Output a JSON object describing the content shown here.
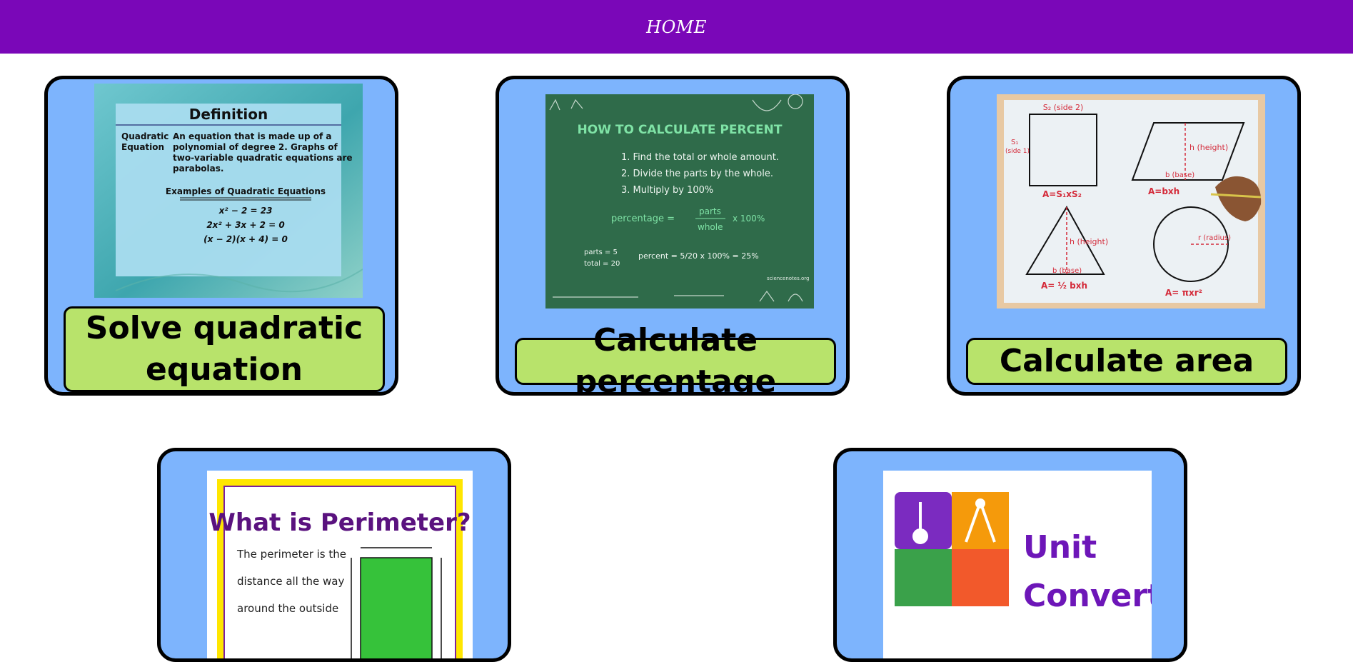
{
  "nav": {
    "home": "HOME"
  },
  "colors": {
    "header": "#7a07b8",
    "card_bg": "#7db4fd",
    "label_bg": "#b8e36b",
    "border": "#000000"
  },
  "cards": [
    {
      "label": "Solve quadratic equation",
      "thumb": {
        "title": "Definition",
        "term": "Quadratic Equation",
        "term_line1": "Quadratic",
        "term_line2": "Equation",
        "def_lines": [
          "An equation that is made up of a",
          "polynomial of degree 2. Graphs of",
          "two-variable quadratic equations are",
          "parabolas."
        ],
        "examples_heading": "Examples of Quadratic Equations",
        "examples": [
          "x² − 2 = 23",
          "2x² + 3x + 2 = 0",
          "(x − 2)(x + 4) = 0"
        ]
      }
    },
    {
      "label": "Calculate percentage",
      "thumb": {
        "title": "HOW TO CALCULATE PERCENT",
        "steps": [
          "1.  Find the total or whole amount.",
          "2.  Divide the parts by the whole.",
          "3.            Multiply by 100%"
        ],
        "formula_left": "percentage =",
        "formula_num": "parts",
        "formula_den": "whole",
        "formula_right": "x 100%",
        "given_1": "parts = 5",
        "given_2": "total = 20",
        "example": "percent = 5/20 x 100% = 25%",
        "credit": "sciencenotes.org"
      }
    },
    {
      "label": "Calculate area",
      "thumb": {
        "square_top": "S₂ (side 2)",
        "square_left_1": "S₁",
        "square_left_2": "(side 1)",
        "square_formula": "A=S₁xS₂",
        "para_height": "h (height)",
        "para_base": "b (base)",
        "para_formula": "A=bxh",
        "tri_height": "h (height)",
        "tri_base": "b (base)",
        "tri_formula": "A= ½ bxh",
        "circle_radius": "r (radius)",
        "circle_formula": "A= πxr²"
      }
    },
    {
      "label": "",
      "thumb": {
        "title": "What is Perimeter?",
        "lines": [
          "The perimeter is the",
          "distance all the way",
          "around the outside"
        ]
      }
    },
    {
      "label": "",
      "thumb": {
        "line1": "Unit",
        "line2": "Converter"
      }
    }
  ]
}
